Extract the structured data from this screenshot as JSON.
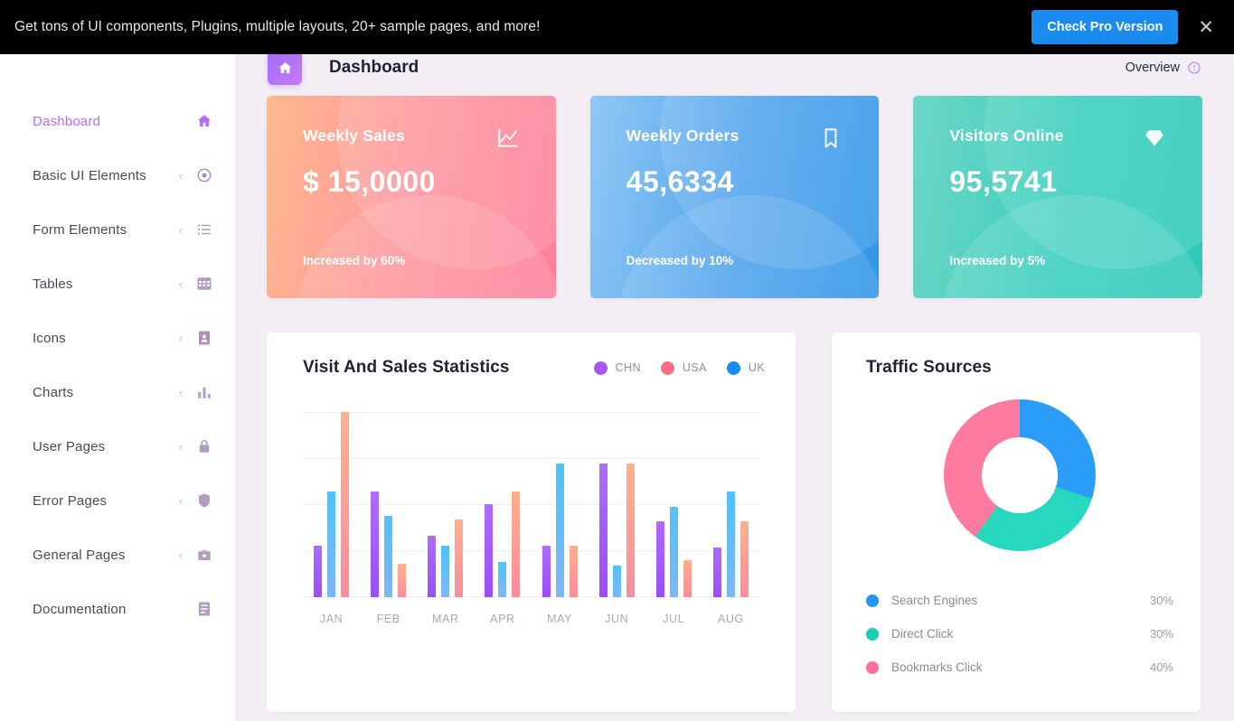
{
  "banner": {
    "message": "Get tons of UI components, Plugins, multiple layouts, 20+ sample pages, and more!",
    "cta_label": "Check Pro Version",
    "close_label": "✕",
    "bg_color": "#000000",
    "cta_color": "#1a8cf0"
  },
  "sidebar": {
    "items": [
      {
        "label": "Dashboard",
        "icon": "home-icon",
        "has_arrow": false,
        "active": true
      },
      {
        "label": "Basic UI Elements",
        "icon": "target-icon",
        "has_arrow": true,
        "active": false
      },
      {
        "label": "Form Elements",
        "icon": "list-icon",
        "has_arrow": true,
        "active": false
      },
      {
        "label": "Tables",
        "icon": "grid-icon",
        "has_arrow": true,
        "active": false
      },
      {
        "label": "Icons",
        "icon": "contact-icon",
        "has_arrow": true,
        "active": false
      },
      {
        "label": "Charts",
        "icon": "bar-chart-icon",
        "has_arrow": true,
        "active": false
      },
      {
        "label": "User Pages",
        "icon": "lock-icon",
        "has_arrow": true,
        "active": false
      },
      {
        "label": "Error Pages",
        "icon": "shield-icon",
        "has_arrow": true,
        "active": false
      },
      {
        "label": "General Pages",
        "icon": "briefcase-icon",
        "has_arrow": true,
        "active": false
      },
      {
        "label": "Documentation",
        "icon": "document-icon",
        "has_arrow": false,
        "active": false
      }
    ],
    "active_color": "#b66dff",
    "arrow_glyph": "‹"
  },
  "header": {
    "title": "Dashboard",
    "icon": "home-icon",
    "overview_label": "Overview",
    "overview_icon": "alert-circle-icon"
  },
  "cards": [
    {
      "title": "Weekly Sales",
      "value": "$ 15,0000",
      "change": "Increased by 60%",
      "icon": "line-chart-icon",
      "theme": "sales",
      "color_from": "#ffb88c",
      "color_to": "#fd7f9a"
    },
    {
      "title": "Weekly Orders",
      "value": "45,6334",
      "change": "Decreased by 10%",
      "icon": "bookmark-icon",
      "theme": "orders",
      "color_from": "#90c8f5",
      "color_to": "#2f96e8"
    },
    {
      "title": "Visitors Online",
      "value": "95,5741",
      "change": "Increased by 5%",
      "icon": "diamond-icon",
      "theme": "visitors",
      "color_from": "#6fd6c6",
      "color_to": "#2ec9b8"
    }
  ],
  "panels": {
    "visits_title": "Visit And Sales Statistics",
    "traffic_title": "Traffic Sources"
  },
  "chart_data": [
    {
      "type": "bar",
      "title": "Visit And Sales Statistics",
      "categories": [
        "JAN",
        "FEB",
        "MAR",
        "APR",
        "MAY",
        "JUN",
        "JUL",
        "AUG"
      ],
      "xlabel": "",
      "ylabel": "",
      "ylim": [
        0,
        100
      ],
      "grid": true,
      "legend_position": "top-right",
      "series": [
        {
          "name": "CHN",
          "color": "#a855f7",
          "values": [
            28,
            57,
            33,
            50,
            28,
            72,
            41,
            27
          ]
        },
        {
          "name": "USA",
          "color": "#fc8c9c",
          "values": [
            100,
            18,
            42,
            57,
            28,
            72,
            20,
            41
          ]
        },
        {
          "name": "UK",
          "color": "#4cb8f0",
          "values": [
            57,
            44,
            28,
            19,
            72,
            17,
            49,
            57
          ]
        }
      ]
    },
    {
      "type": "pie",
      "title": "Traffic Sources",
      "subtype": "donut",
      "labels": [
        "Search Engines",
        "Direct Click",
        "Bookmarks Click"
      ],
      "values": [
        30,
        30,
        40
      ],
      "value_labels": [
        "30%",
        "30%",
        "40%"
      ],
      "colors": [
        "#2196f3",
        "#1bcfb4",
        "#fe7096"
      ],
      "slice_gradients": [
        {
          "from": "#4fd8e8",
          "to": "#5a9ef0"
        },
        {
          "from": "#7fd8c6",
          "to": "#8cd9c4"
        },
        {
          "from": "#f66c77",
          "to": "#fb9a8e"
        }
      ],
      "legend_position": "bottom"
    }
  ]
}
